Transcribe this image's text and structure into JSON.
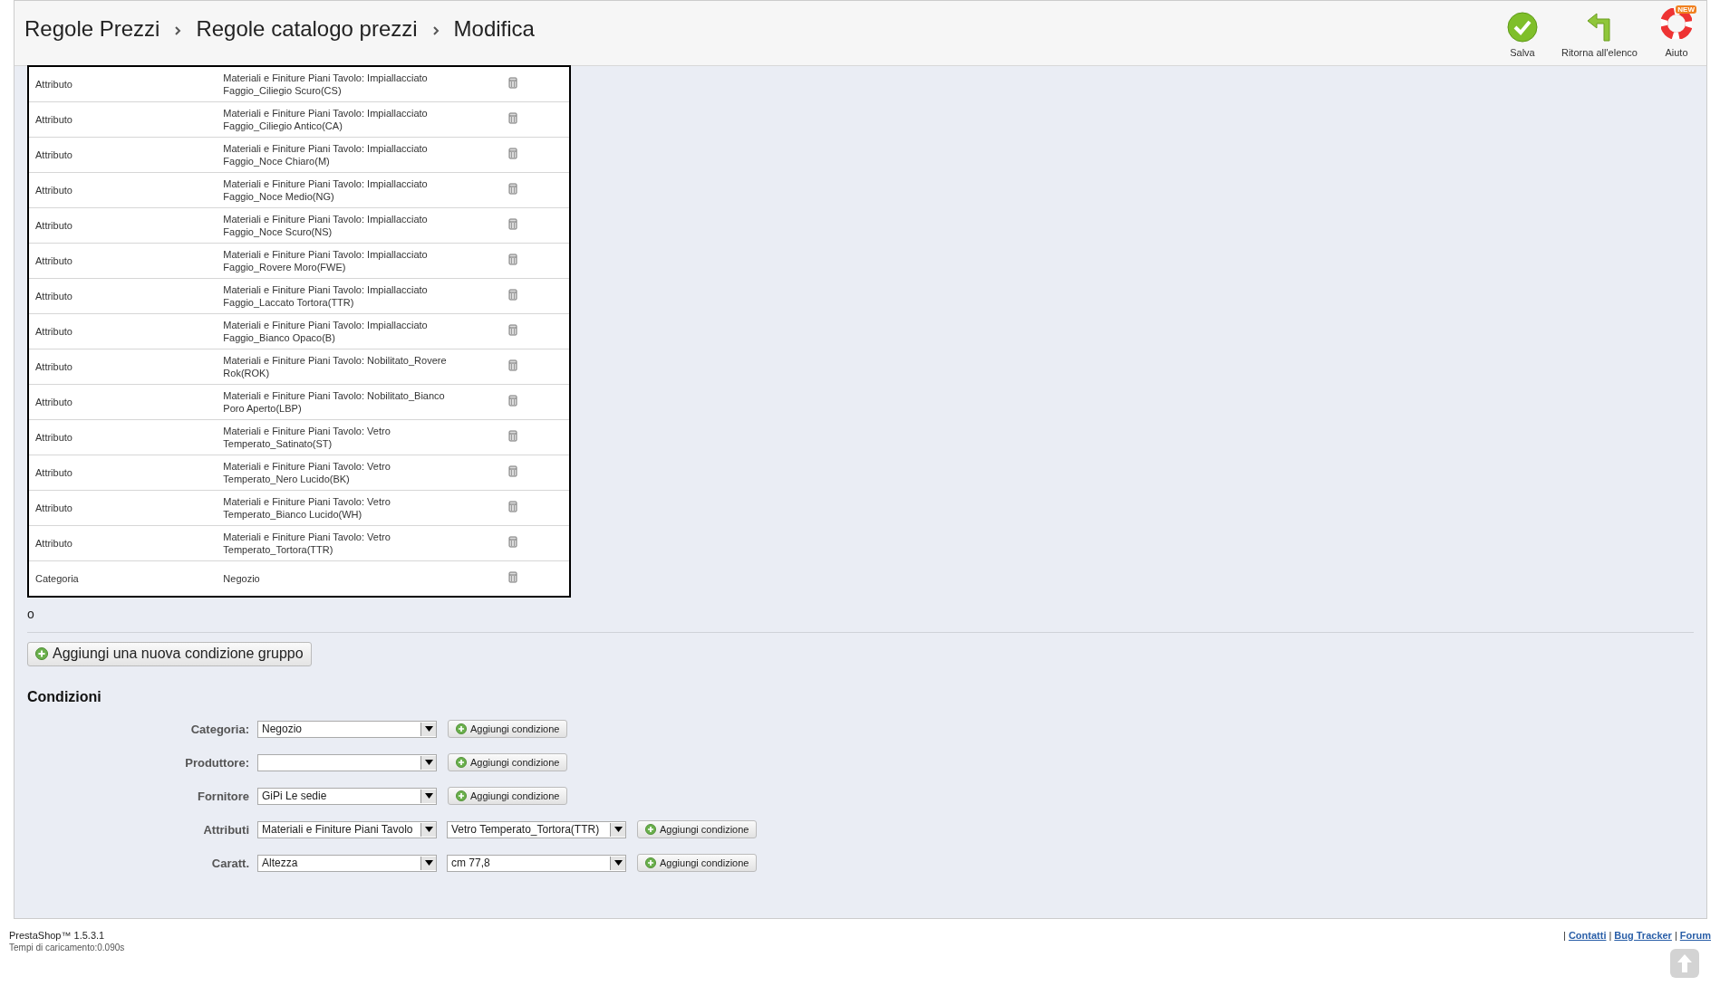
{
  "toolbar": {
    "breadcrumb": [
      "Regole Prezzi",
      "Regole catalogo prezzi",
      "Modifica"
    ],
    "buttons": [
      {
        "kind": "save",
        "label": "Salva"
      },
      {
        "kind": "back",
        "label": "Ritorna all'elenco"
      },
      {
        "kind": "help",
        "label": "Aiuto",
        "badge": "NEW"
      }
    ]
  },
  "rules_table": {
    "rows": [
      {
        "type": "Attributo",
        "value": "Materiali e Finiture Piani Tavolo: Impiallacciato Faggio_Ciliegio Scuro(CS)"
      },
      {
        "type": "Attributo",
        "value": "Materiali e Finiture Piani Tavolo: Impiallacciato Faggio_Ciliegio Antico(CA)"
      },
      {
        "type": "Attributo",
        "value": "Materiali e Finiture Piani Tavolo: Impiallacciato Faggio_Noce Chiaro(M)"
      },
      {
        "type": "Attributo",
        "value": "Materiali e Finiture Piani Tavolo: Impiallacciato Faggio_Noce Medio(NG)"
      },
      {
        "type": "Attributo",
        "value": "Materiali e Finiture Piani Tavolo: Impiallacciato Faggio_Noce Scuro(NS)"
      },
      {
        "type": "Attributo",
        "value": "Materiali e Finiture Piani Tavolo: Impiallacciato Faggio_Rovere Moro(FWE)"
      },
      {
        "type": "Attributo",
        "value": "Materiali e Finiture Piani Tavolo: Impiallacciato Faggio_Laccato Tortora(TTR)"
      },
      {
        "type": "Attributo",
        "value": "Materiali e Finiture Piani Tavolo: Impiallacciato Faggio_Bianco Opaco(B)"
      },
      {
        "type": "Attributo",
        "value": "Materiali e Finiture Piani Tavolo: Nobilitato_Rovere Rok(ROK)"
      },
      {
        "type": "Attributo",
        "value": "Materiali e Finiture Piani Tavolo: Nobilitato_Bianco Poro Aperto(LBP)"
      },
      {
        "type": "Attributo",
        "value": "Materiali e Finiture Piani Tavolo: Vetro Temperato_Satinato(ST)"
      },
      {
        "type": "Attributo",
        "value": "Materiali e Finiture Piani Tavolo: Vetro Temperato_Nero Lucido(BK)"
      },
      {
        "type": "Attributo",
        "value": "Materiali e Finiture Piani Tavolo: Vetro Temperato_Bianco Lucido(WH)"
      },
      {
        "type": "Attributo",
        "value": "Materiali e Finiture Piani Tavolo: Vetro Temperato_Tortora(TTR)"
      },
      {
        "type": "Categoria",
        "value": "Negozio"
      }
    ]
  },
  "or_label": "o",
  "add_group_button": "Aggiungi una nuova condizione gruppo",
  "conditions": {
    "title": "Condizioni",
    "rows": [
      {
        "label": "Categoria:",
        "selects": [
          {
            "value": "Negozio"
          }
        ],
        "button": "Aggiungi condizione"
      },
      {
        "label": "Produttore:",
        "button": "Aggiungi condizione"
      },
      {
        "label": "Fornitore",
        "selects": [
          {
            "value": "GiPi Le sedie"
          }
        ],
        "button": "Aggiungi condizione"
      },
      {
        "label": "Attributi",
        "selects": [
          {
            "value": "Materiali e Finiture Piani Tavolo"
          },
          {
            "value": "Vetro Temperato_Tortora(TTR)"
          }
        ],
        "button": "Aggiungi condizione"
      },
      {
        "label": "Caratt.",
        "selects": [
          {
            "value": "Altezza"
          },
          {
            "value": "cm 77,8"
          }
        ],
        "button": "Aggiungi condizione"
      }
    ]
  },
  "footer": {
    "version": "PrestaShop™ 1.5.3.1",
    "load_time": "Tempi di caricamento:0.090s",
    "separator": "|",
    "links": [
      "Contatti",
      "Bug Tracker",
      "Forum"
    ]
  }
}
